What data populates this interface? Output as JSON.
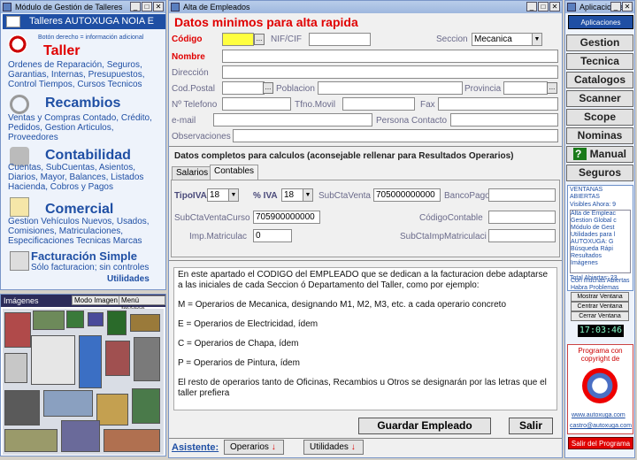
{
  "left_window": {
    "title": "Módulo de Gestión de Talleres",
    "header": "Talleres AUTOXUGA NOIA E",
    "hint": "Botón derecho = información adicional",
    "sections": [
      {
        "title": "Taller",
        "text": "Ordenes de Reparación, Seguros, Garantias, Internas, Presupuestos, Control Tiempos, Cursos Tecnicos"
      },
      {
        "title": "Recambios",
        "text": "Ventas y Compras Contado, Crédito, Pedidos, Gestion Articulos, Proveedores"
      },
      {
        "title": "Contabilidad",
        "text": "Cuentas, SubCuentas, Asientos, Diarios, Mayor, Balances, Listados Hacienda, Cobros y Pagos"
      },
      {
        "title": "Comercial",
        "text": "Gestion Vehículos Nuevos, Usados, Comisiones, Matriculaciones, Especificaciones Tecnicas Marcas"
      },
      {
        "title": "Facturación Simple",
        "text": "Sólo facturacion; sin controles"
      }
    ],
    "utilidades": "Utilidades"
  },
  "images_window": {
    "title": "Imágenes",
    "mode_button": "Modo Imagen",
    "menu_button": "Menú Imágen"
  },
  "main_window": {
    "title": "Alta de Empleados",
    "heading": "Datos minimos para alta rapida",
    "labels": {
      "codigo": "Código",
      "nif": "NIF/CIF",
      "seccion": "Seccion",
      "nombre": "Nombre",
      "direccion": "Dirección",
      "cod_postal": "Cod.Postal",
      "poblacion": "Poblacion",
      "provincia": "Provincia",
      "telefono": "Nº Telefono",
      "tfno_movil": "Tfno.Movil",
      "fax": "Fax",
      "email": "e-mail",
      "persona_contacto": "Persona Contacto",
      "observaciones": "Observaciones"
    },
    "values": {
      "seccion": "Mecanica"
    },
    "calc_heading": "Datos completos para calculos (aconsejable rellenar para Resultados Operarios)",
    "tabs": [
      "Salarios",
      "Contables"
    ],
    "contables": {
      "tipo_iva_label": "TipoIVA",
      "tipo_iva_value": "18",
      "pct_iva_label": "% IVA",
      "pct_iva_value": "18",
      "subcta_venta_label": "SubCtaVenta",
      "subcta_venta_value": "705000000000",
      "banco_pago_label": "BancoPago",
      "subcta_venta_curso_label": "SubCtaVentaCurso",
      "subcta_venta_curso_value": "705900000000",
      "codigo_contable_label": "CódigoContable",
      "imp_matriculac_label": "Imp.Matriculac",
      "imp_matriculac_value": "0",
      "subcta_imp_matriculaci_label": "SubCtaImpMatriculaci"
    },
    "info_paragraphs": [
      "En este apartado el CODIGO del EMPLEADO que se dedican a la facturacion debe adaptarse a las iniciales de cada Seccion ó Departamento del Taller, como por ejemplo:",
      "M = Operarios de Mecanica, designando M1, M2, M3, etc. a cada operario concreto",
      "E = Operarios de Electricidad, ídem",
      "C = Operarios de Chapa, ídem",
      "P = Operarios de Pintura, ídem",
      "El resto de operarios tanto de Oficinas, Recambios u Otros se designarán por las letras que el taller prefiera"
    ],
    "save_button": "Guardar Empleado",
    "exit_button": "Salir",
    "asistente_label": "Asistente:",
    "operarios_button": "Operarios",
    "utilidades_button": "Utilidades"
  },
  "right_window": {
    "title": "Aplicaciones",
    "header": "Aplicaciones",
    "buttons": [
      "Gestion",
      "Tecnica",
      "Catalogos",
      "Scanner",
      "Scope",
      "Nominas",
      "Manual",
      "Seguros"
    ],
    "ventanas_title": "VENTANAS ABIERTAS",
    "visibles": "Visibles Ahora: 9",
    "ventanas": [
      "Alta de Empleac",
      "Gestion Global c",
      "Módulo de Gest",
      "Utilidades para l",
      "AUTOXUGA: G",
      "Búsqueda Rápi",
      "Resultados",
      "Imágenes"
    ],
    "total_abiertas": "Total Abiertas: 23",
    "con_muchas": "Con muchas Abiertas Habra Problemas",
    "mostrar": "Mostrar Ventana",
    "centrar": "Centrar Ventana",
    "cerrar": "Cerrar Ventana",
    "clock": "17:03:46",
    "copyright": "Programa con copyright de",
    "web": "www.autoxuga.com",
    "email": "castro@autoxuga.com",
    "salir": "Salir del Programa"
  }
}
